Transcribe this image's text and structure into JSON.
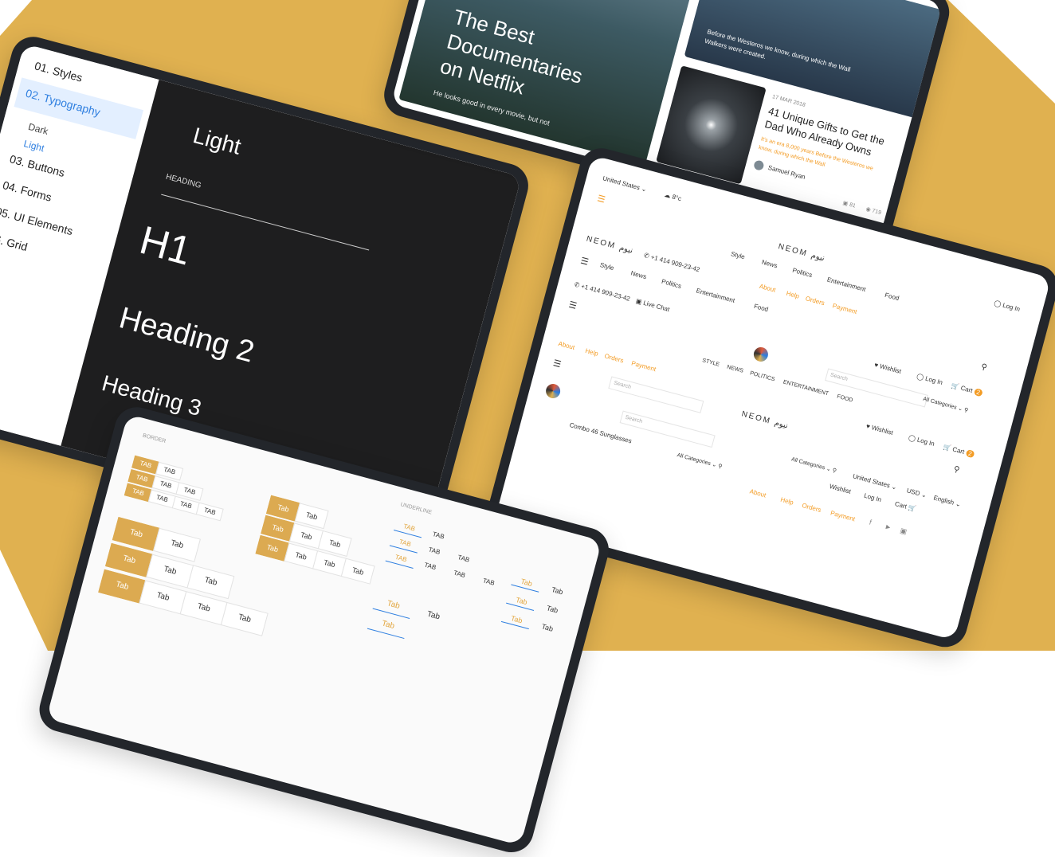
{
  "colors": {
    "gold": "#e0b150",
    "dark": "#1e1e1f",
    "accent_blue": "#2f7fe0",
    "accent_orange": "#f39c25"
  },
  "typography": {
    "sidebar": [
      "01. Styles",
      "02. Typography",
      "Dark",
      "Light",
      "03. Buttons",
      "04. Forms",
      "05. UI Elements",
      "06. Grid"
    ],
    "theme_label": "Light",
    "heading_label": "HEADING",
    "h1": "H1",
    "h2": "Heading 2",
    "h3": "Heading 3"
  },
  "news": {
    "hero_title_line1": "The Best",
    "hero_title_line2": "Documentaries",
    "hero_title_line3": "on Netflix",
    "hero_sub": "He looks good in every movie, but not",
    "top_excerpt1": "Before the Westeros we know, during which the Wall",
    "top_excerpt2": "Walkers were created.",
    "card_date": "17 MAR 2018",
    "card_title_line1": "41 Unique Gifts to Get the",
    "card_title_line2": "Dad Who Already Owns",
    "card_excerpt1": "It's an era 8,000 years Before the Westeros we",
    "card_excerpt2": "know, during which the Wall",
    "author": "Samuel Ryan",
    "comments": "81",
    "views": "719"
  },
  "header": {
    "country": "United States",
    "weather": "8°c",
    "logo": "NEOM نيوم",
    "phone": "+1 414 909-23-42",
    "nav": [
      "Style",
      "News",
      "Politics",
      "Entertainment",
      "Food"
    ],
    "nav_caps": [
      "STYLE",
      "NEWS",
      "POLITICS",
      "ENTERTAINMENT",
      "FOOD"
    ],
    "links": [
      "About",
      "Help",
      "Orders",
      "Payment"
    ],
    "login": "Log In",
    "wishlist": "Wishlist",
    "cart": "Cart",
    "cart_count": "2",
    "live_chat": "Live Chat",
    "search": "Search",
    "all_categories": "All Categories",
    "currency": "USD",
    "language": "English",
    "promo": "Combo 46 Sunglasses"
  },
  "tabs": {
    "border_label": "BORDER",
    "underline_label": "UNDERLINE",
    "small_tab": "TAB",
    "tab": "Tab"
  }
}
